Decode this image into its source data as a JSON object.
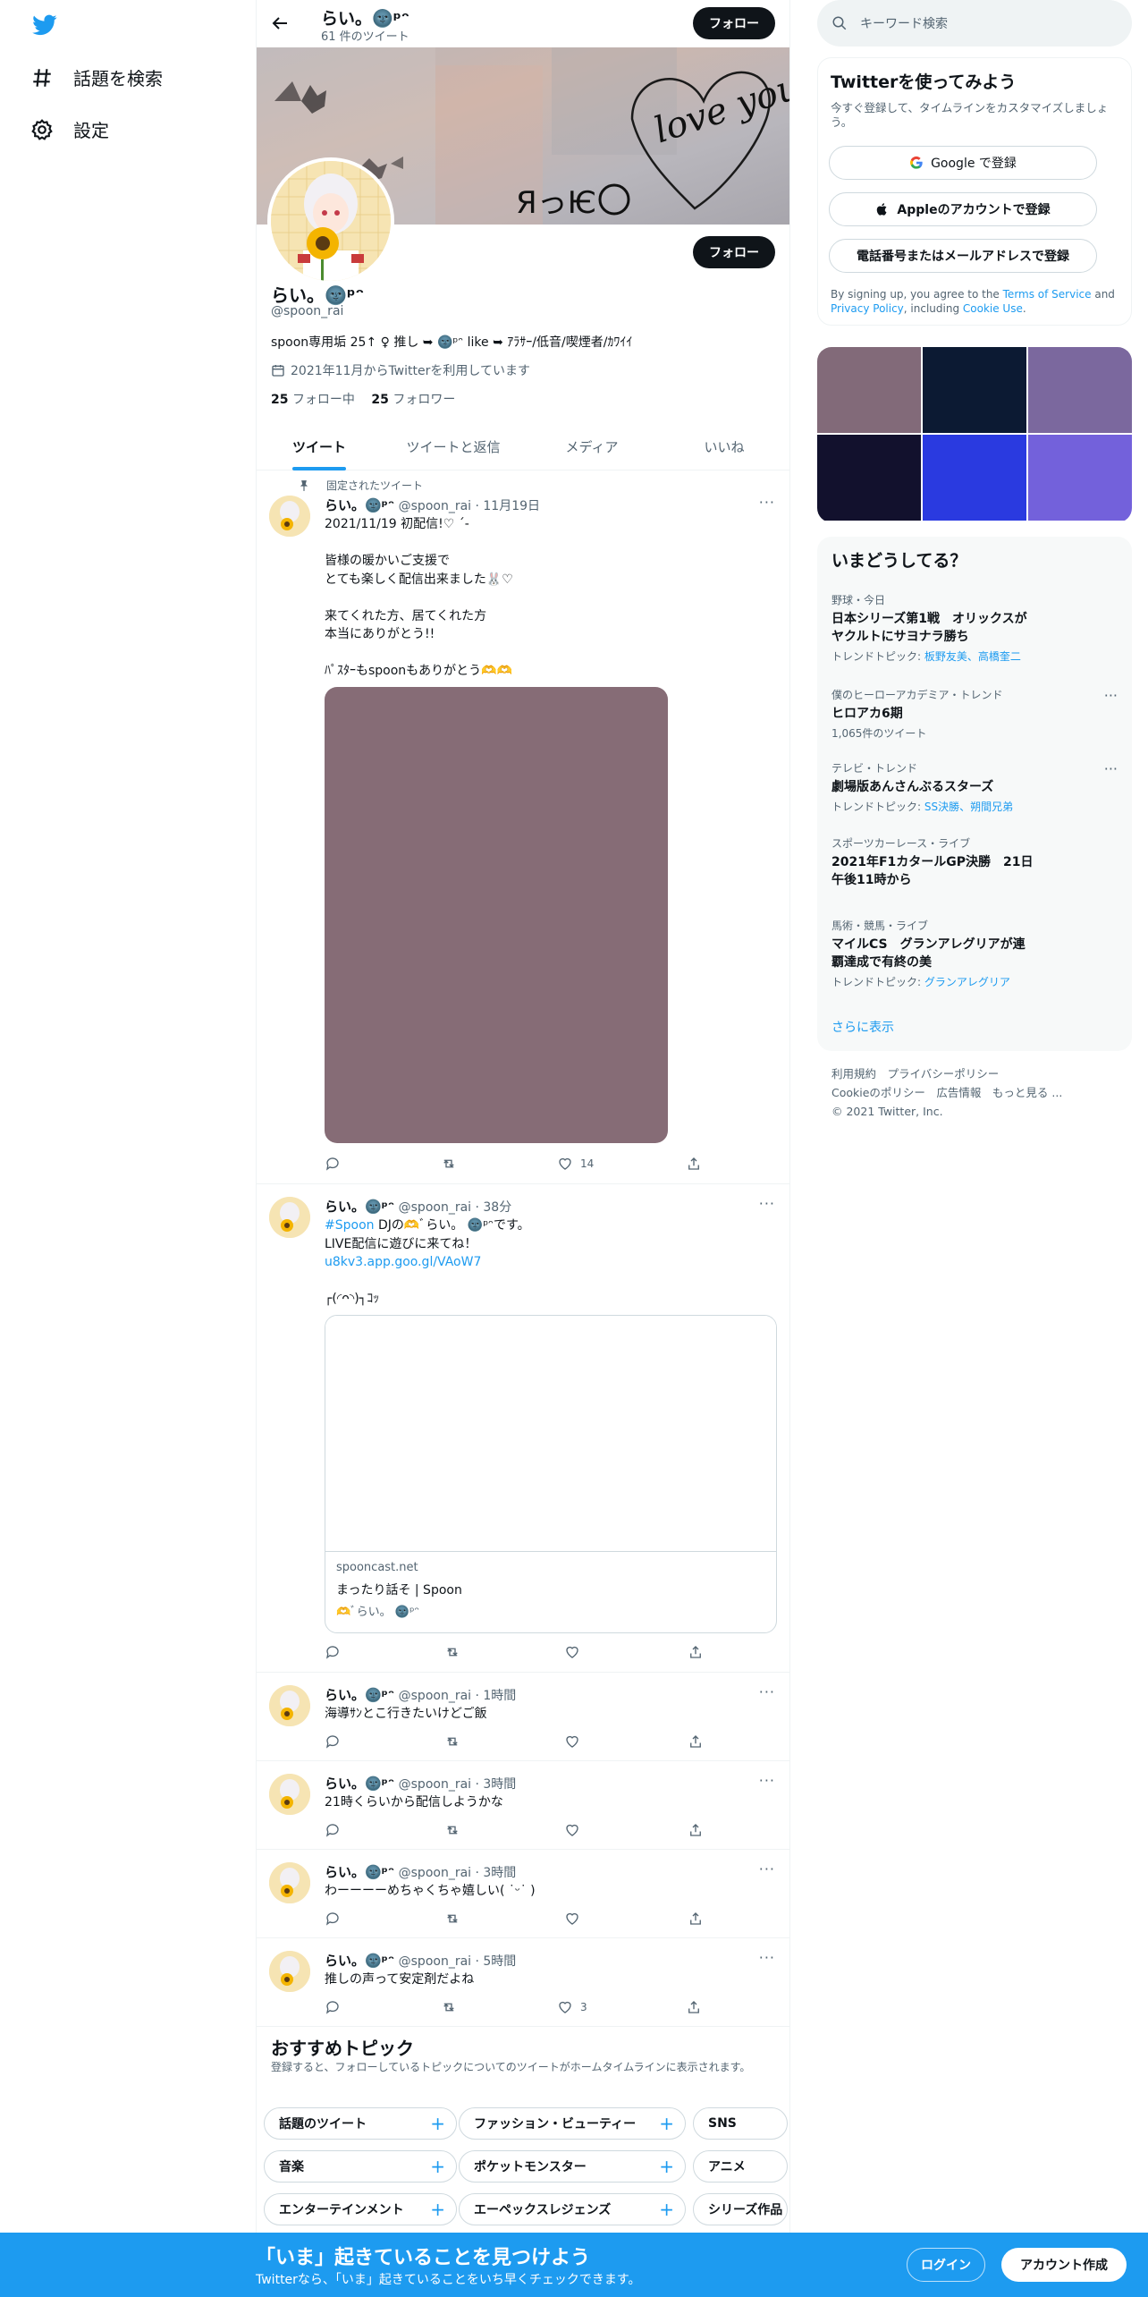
{
  "colors": {
    "accent": "#1d9bf0",
    "text": "#0f1419",
    "muted": "#536471"
  },
  "nav": {
    "items": [
      {
        "label": "話題を検索",
        "icon": "hashtag-icon"
      },
      {
        "label": "設定",
        "icon": "gear-icon"
      }
    ]
  },
  "header": {
    "name": "らい。🌚ᵖᵔ",
    "tweet_count": "61 件のツイート",
    "follow_label": "フォロー"
  },
  "banner": {
    "text_left": "ЯっѤ",
    "text_right": "love you"
  },
  "profile": {
    "name": "らい。🌚ᵖᵔ",
    "handle": "@spoon_rai",
    "bio": "spoon専用垢 25↑ ♀ 推し ➥ 🌚ᵖᵔ like ➥ ｱﾗｻｰ/低音/喫煙者/ｶﾜｲｲ",
    "joined": "2021年11月からTwitterを利用しています",
    "following_count": "25",
    "following_label": "フォロー中",
    "followers_count": "25",
    "followers_label": "フォロワー",
    "follow_label": "フォロー"
  },
  "tabs": [
    "ツイート",
    "ツイートと返信",
    "メディア",
    "いいね"
  ],
  "pinned_label": "固定されたツイート",
  "tweets": [
    {
      "name": "らい。🌚ᵖᵔ",
      "meta": "@spoon_rai · 11月19日",
      "text": "2021/11/19 初配信!♡ ˊ-\n\n皆様の暖かいご支援で\nとても楽しく配信出来ました🐰♡\n\n来てくれた方、居てくれた方\n本当にありがとう!!\n\nﾊﾟｽﾀｰもspoonもありがとう🫶🫶",
      "likes": "14",
      "media_color": "#866c76"
    },
    {
      "name": "らい。🌚ᵖᵔ",
      "meta": "@spoon_rai · 38分",
      "hashtag": "#Spoon",
      "text": " DJの🫶ﾞらい。 🌚ᵖᵔです。\nLIVE配信に遊びに来てね！",
      "link": "u8kv3.app.goo.gl/VAoW7",
      "extra": "┌(◜ᴖ◝)┐ｺｯ",
      "card_domain": "spooncast.net",
      "card_title": "まったり話そ | Spoon",
      "card_desc": "🫶ﾞらい。 🌚ᵖᵔ"
    },
    {
      "name": "らい。🌚ᵖᵔ",
      "meta": "@spoon_rai · 1時間",
      "text": "海導ｻﾝとこ行きたいけどご飯"
    },
    {
      "name": "らい。🌚ᵖᵔ",
      "meta": "@spoon_rai · 3時間",
      "text": "21時くらいから配信しようかな"
    },
    {
      "name": "らい。🌚ᵖᵔ",
      "meta": "@spoon_rai · 3時間",
      "text": "わーーーーめちゃくちゃ嬉しい( ˙ᵕ˙ )"
    },
    {
      "name": "らい。🌚ᵖᵔ",
      "meta": "@spoon_rai · 5時間",
      "text": "推しの声って安定剤だよね",
      "likes": "3"
    }
  ],
  "topics": {
    "title": "おすすめトピック",
    "subtitle": "登録すると、フォローしているトピックについてのツイートがホームタイムラインに表示されます。",
    "chips": [
      [
        "話題のツイート",
        "ファッション・ビューティー",
        "SNS"
      ],
      [
        "音楽",
        "ポケットモンスター",
        "アニメ"
      ],
      [
        "エンターテインメント",
        "エーペックスレジェンズ",
        "シリーズ作品"
      ]
    ]
  },
  "search": {
    "placeholder": "キーワード検索"
  },
  "signup": {
    "title": "Twitterを使ってみよう",
    "subtitle": "今すぐ登録して、タイムラインをカスタマイズしましょう。",
    "google": "Google で登録",
    "apple": "Appleのアカウントで登録",
    "phone": "電話番号またはメールアドレスで登録",
    "legal_prefix": "By signing up, you agree to the ",
    "legal_terms": "Terms of Service",
    "legal_and": " and ",
    "legal_privacy": "Privacy Policy",
    "legal_including": ", including ",
    "legal_cookie": "Cookie Use",
    "legal_end": "."
  },
  "photo_grid": [
    "#826a79",
    "#0c1a33",
    "#7b689e",
    "#12112d",
    "#2a3ae0",
    "#7361db"
  ],
  "trends": {
    "title": "いまどうしてる？",
    "items": [
      {
        "category": "野球・今日",
        "name": "日本シリーズ第1戦　オリックスがヤクルトにサヨナラ勝ち",
        "meta_prefix": "トレンドトピック: ",
        "meta_links": "板野友美、高橋奎二",
        "dots": false
      },
      {
        "category": "僕のヒーローアカデミア・トレンド",
        "name": "ヒロアカ6期",
        "meta_plain": "1,065件のツイート",
        "dots": true
      },
      {
        "category": "テレビ・トレンド",
        "name": "劇場版あんさんぶるスターズ",
        "meta_prefix": "トレンドトピック: ",
        "meta_links": "SS決勝、朔間兄弟",
        "dots": true
      },
      {
        "category": "スポーツカーレース・ライブ",
        "name": "2021年F1カタールGP決勝　21日午後11時から",
        "dots": false
      },
      {
        "category": "馬術・競馬・ライブ",
        "name": "マイルCS　グランアレグリアが連覇達成で有終の美",
        "meta_prefix": "トレンドトピック: ",
        "meta_links": "グランアレグリア",
        "dots": false
      }
    ],
    "more": "さらに表示"
  },
  "footer": {
    "line1": "利用規約　プライバシーポリシー",
    "line2": "Cookieのポリシー　広告情報　もっと見る ...",
    "line3": "© 2021 Twitter, Inc."
  },
  "bottombar": {
    "title": "「いま」起きていることを見つけよう",
    "subtitle": "Twitterなら、「いま」起きていることをいち早くチェックできます。",
    "login": "ログイン",
    "signup": "アカウント作成"
  }
}
